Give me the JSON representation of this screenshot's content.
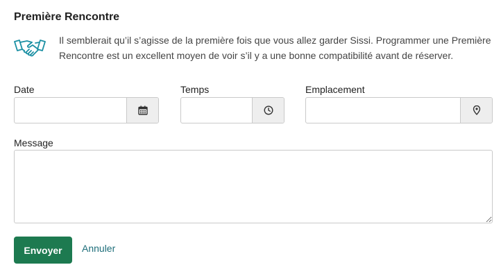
{
  "form": {
    "title": "Première Rencontre",
    "intro_icon": "handshake-icon",
    "intro_text": "Il semblerait qu’il s’agisse de la première fois que vous allez garder Sissi. Programmer une Première Rencontre est un excellent moyen de voir s’il y a une bonne compatibilité avant de réserver.",
    "accent_color": "#1d7a50",
    "link_color": "#1e6e7a",
    "icon_color": "#1a8fa3",
    "date": {
      "label": "Date",
      "value": "",
      "icon": "calendar-icon"
    },
    "time": {
      "label": "Temps",
      "value": "",
      "icon": "clock-icon"
    },
    "location": {
      "label": "Emplacement",
      "value": "",
      "icon": "map-pin-icon"
    },
    "message": {
      "label": "Message",
      "value": ""
    },
    "submit_label": "Envoyer",
    "cancel_label": "Annuler"
  }
}
